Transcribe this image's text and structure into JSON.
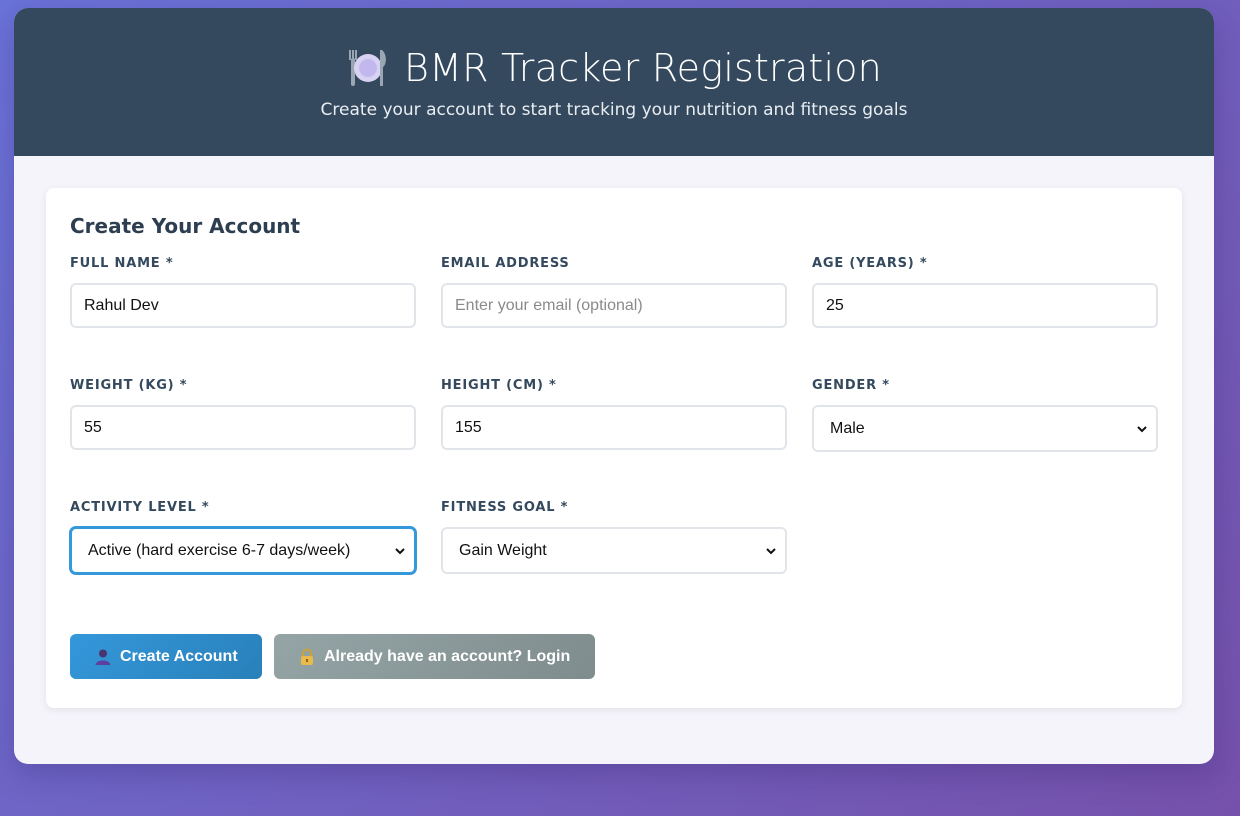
{
  "header": {
    "title": "BMR Tracker Registration",
    "subtitle": "Create your account to start tracking your nutrition and fitness goals",
    "icon": "plate-cutlery-icon"
  },
  "form": {
    "title": "Create Your Account",
    "fields": {
      "full_name": {
        "label": "FULL NAME *",
        "value": "Rahul Dev"
      },
      "email": {
        "label": "EMAIL ADDRESS",
        "value": "",
        "placeholder": "Enter your email (optional)"
      },
      "age": {
        "label": "AGE (YEARS) *",
        "value": "25"
      },
      "weight": {
        "label": "WEIGHT (KG) *",
        "value": "55"
      },
      "height": {
        "label": "HEIGHT (CM) *",
        "value": "155"
      },
      "gender": {
        "label": "GENDER *",
        "selected": "Male"
      },
      "activity": {
        "label": "ACTIVITY LEVEL *",
        "selected": "Active (hard exercise 6-7 days/week)"
      },
      "goal": {
        "label": "FITNESS GOAL *",
        "selected": "Gain Weight"
      }
    },
    "buttons": {
      "create": {
        "label": "Create Account",
        "icon": "user-icon"
      },
      "login": {
        "label": "Already have an account? Login",
        "icon": "lock-icon"
      }
    }
  },
  "colors": {
    "header_bg": "#34495e",
    "primary": "#3498db",
    "secondary": "#95a5a6",
    "focus": "#3498db"
  }
}
